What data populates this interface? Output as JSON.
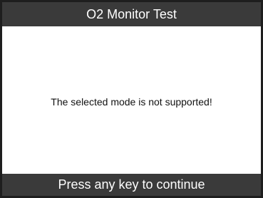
{
  "header": {
    "title": "O2 Monitor Test"
  },
  "main": {
    "message": "The selected mode is not supported!"
  },
  "footer": {
    "prompt": "Press any key to continue"
  },
  "colors": {
    "bar_background": "#3a3a3a",
    "bar_text": "#ffffff",
    "body_background": "#ffffff",
    "body_text": "#111111",
    "frame_border": "#1e1e1e"
  }
}
